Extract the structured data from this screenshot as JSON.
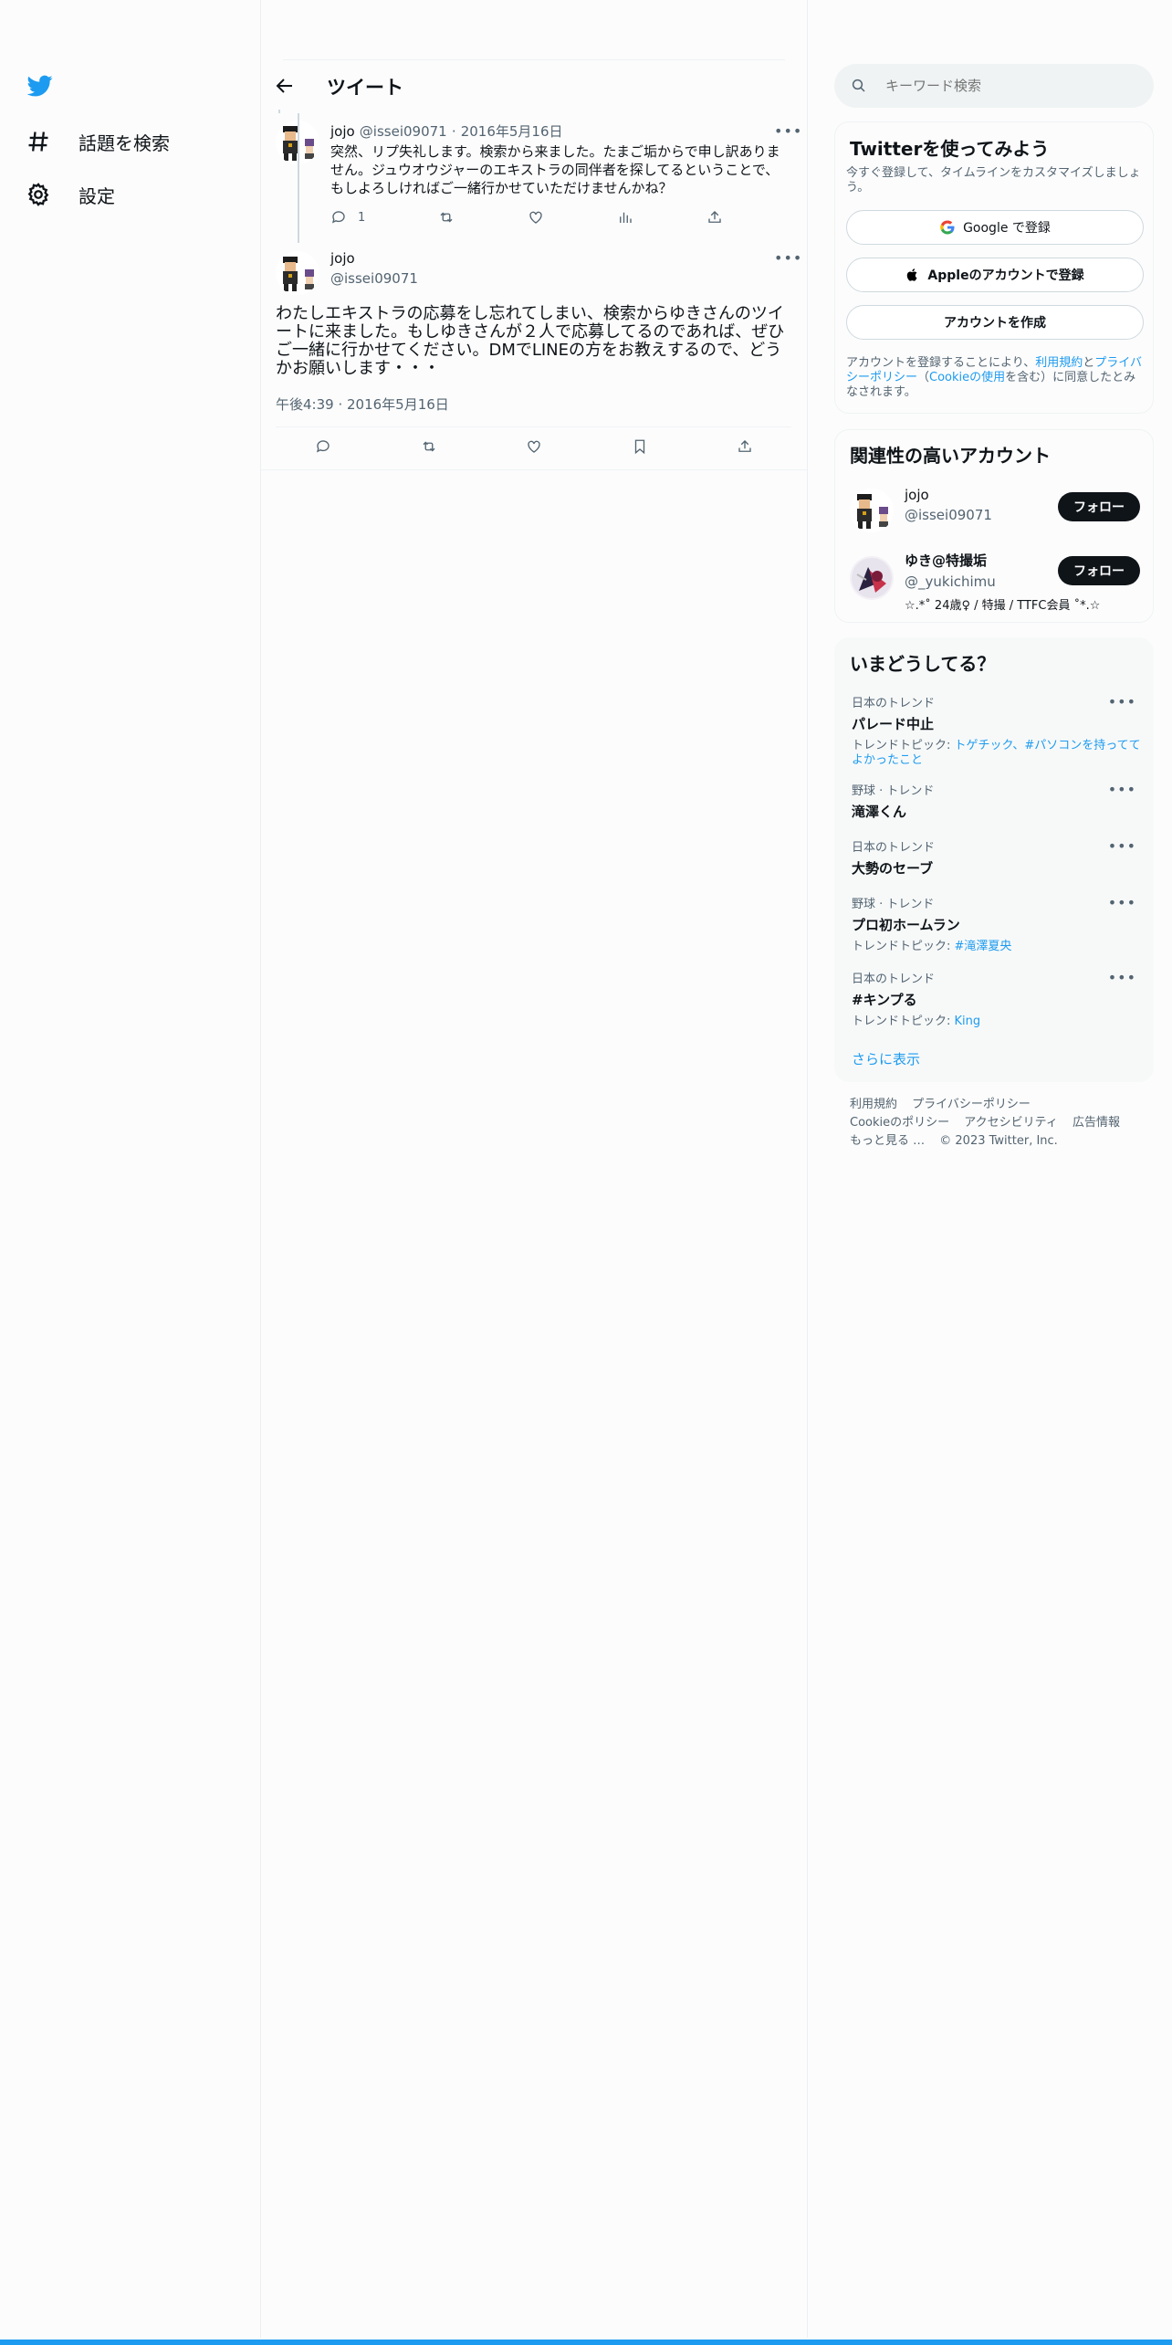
{
  "nav": {
    "explore_label": "話題を検索",
    "settings_label": "設定"
  },
  "header": {
    "title": "ツイート"
  },
  "reply_tweet": {
    "name": "jojo",
    "handle": "@issei09071",
    "date": "2016年5月16日",
    "separator": "·",
    "text": "突然、リプ失礼します。検索から来ました。たまご垢からで申し訳ありません。ジュウオウジャーのエキストラの同伴者を探してるということで、もしよろしければご一緒行かせていただけませんかね？",
    "reply_count": "1"
  },
  "main_tweet": {
    "name": "jojo",
    "handle": "@issei09071",
    "text": "わたしエキストラの応募をし忘れてしまい、検索からゆきさんのツイートに来ました。もしゆきさんが２人で応募してるのであれば、ぜひご一緒に行かせてください。DMでLINEの方をお教えするので、どうかお願いします・・・",
    "timestamp": "午後4:39 · 2016年5月16日"
  },
  "search": {
    "placeholder": "キーワード検索"
  },
  "signup": {
    "title": "Twitterを使ってみよう",
    "subtitle": "今すぐ登録して、タイムラインをカスタマイズしましょう。",
    "google_label": "Google で登録",
    "apple_label": "Appleのアカウントで登録",
    "create_label": "アカウントを作成",
    "legal_prefix": "アカウントを登録することにより、",
    "terms_link": "利用規約",
    "and": "と",
    "privacy_link": "プライバシーポリシー",
    "cookie_open": "（",
    "cookie_link": "Cookieの使用",
    "legal_suffix": "を含む）に同意したとみなされます。"
  },
  "related": {
    "title": "関連性の高いアカウント",
    "accounts": [
      {
        "name": "jojo",
        "handle": "@issei09071",
        "bio": "",
        "follow_label": "フォロー"
      },
      {
        "name": "ゆき@特撮垢",
        "handle": "@_yukichimu",
        "bio": "☆.*˚ 24歳♀ / 特撮 / TTFC会員 ˚*.☆",
        "follow_label": "フォロー"
      }
    ]
  },
  "trends": {
    "title": "いまどうしてる？",
    "items": [
      {
        "category": "日本のトレンド",
        "name": "パレード中止",
        "topic_prefix": "トレンドトピック: ",
        "topic": "トゲチック、#パソコンを持っててよかったこと"
      },
      {
        "category": "野球 · トレンド",
        "name": "滝澤くん",
        "topic_prefix": "",
        "topic": ""
      },
      {
        "category": "日本のトレンド",
        "name": "大勢のセーブ",
        "topic_prefix": "",
        "topic": ""
      },
      {
        "category": "野球 · トレンド",
        "name": "プロ初ホームラン",
        "topic_prefix": "トレンドトピック: ",
        "topic": "#滝澤夏央"
      },
      {
        "category": "日本のトレンド",
        "name": "#キンプる",
        "topic_prefix": "トレンドトピック: ",
        "topic": "King"
      }
    ],
    "show_more": "さらに表示"
  },
  "footer": {
    "terms": "利用規約",
    "privacy": "プライバシーポリシー",
    "cookie": "Cookieのポリシー",
    "accessibility": "アクセシビリティ",
    "ads": "広告情報",
    "more": "もっと見る …",
    "copyright": "© 2023 Twitter, Inc."
  },
  "colors": {
    "accent": "#1d9bf0",
    "text": "#0f1419",
    "muted": "#536471"
  }
}
